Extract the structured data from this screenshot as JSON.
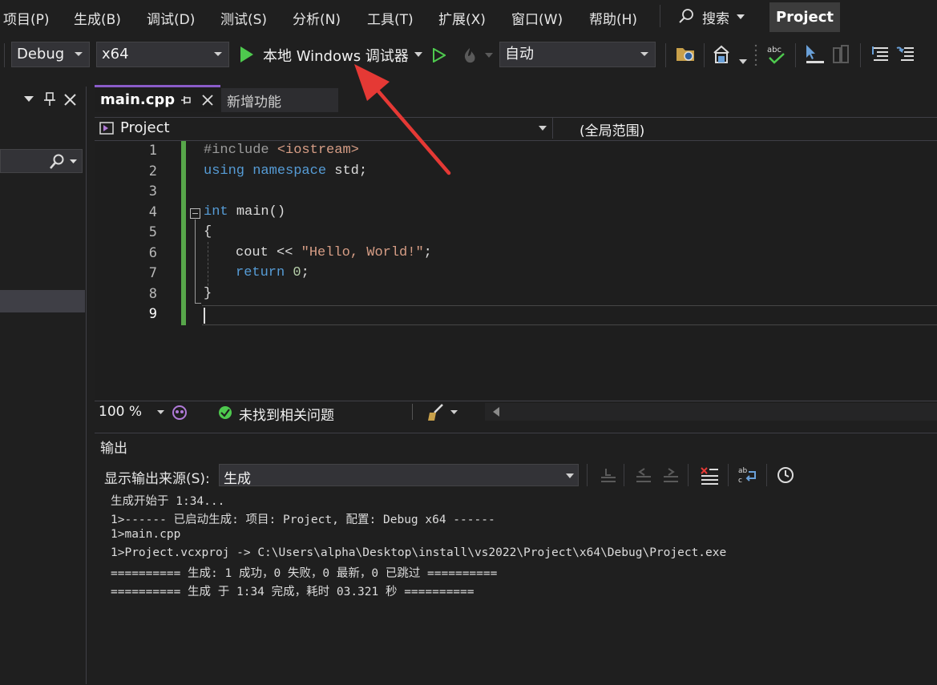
{
  "menu": [
    "项目(P)",
    "生成(B)",
    "调试(D)",
    "测试(S)",
    "分析(N)",
    "工具(T)",
    "扩展(X)",
    "窗口(W)",
    "帮助(H)"
  ],
  "search_label": "搜索",
  "project_badge": "Project",
  "toolbar": {
    "config": "Debug",
    "platform": "x64",
    "run_label": "本地 Windows 调试器",
    "auto_label": "自动"
  },
  "editor": {
    "tabs": [
      "main.cpp",
      "新增功能"
    ],
    "nav_project": "Project",
    "nav_scope": "(全局范围)",
    "line_numbers": [
      "1",
      "2",
      "3",
      "4",
      "5",
      "6",
      "7",
      "8",
      "9"
    ],
    "code": {
      "line1_directive": "#include",
      "line1_header": "<iostream>",
      "line2_using": "using",
      "line2_namespace": "namespace",
      "line2_rest": "std;",
      "line4_type": "int",
      "line4_rest": "main()",
      "line5": "{",
      "line6_cout": "cout <<",
      "line6_string": "\"Hello, World!\"",
      "line6_end": ";",
      "line7_return": "return",
      "line7_value": "0",
      "line7_end": ";",
      "line8": "}"
    }
  },
  "status": {
    "zoom": "100 %",
    "issues": "未找到相关问题"
  },
  "output": {
    "title": "输出",
    "source_label": "显示输出来源(S):",
    "source_value": "生成",
    "lines": [
      "生成开始于 1:34...",
      "1>------ 已启动生成: 项目: Project, 配置: Debug x64 ------",
      "1>main.cpp",
      "1>Project.vcxproj -> C:\\Users\\alpha\\Desktop\\install\\vs2022\\Project\\x64\\Debug\\Project.exe",
      "========== 生成: 1 成功，0 失败，0 最新，0 已跳过 ==========",
      "========== 生成 于 1:34 完成，耗时 03.321 秒 =========="
    ]
  },
  "colors": {
    "accent": "#8a5cc9",
    "run_green": "#4ec94e",
    "arrow_red": "#e53935",
    "change_bar": "#57a64a"
  }
}
